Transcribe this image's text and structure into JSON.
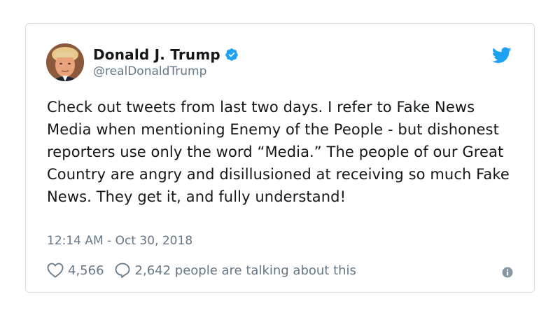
{
  "user": {
    "name": "Donald J. Trump",
    "handle": "@realDonaldTrump"
  },
  "tweet": {
    "text": "Check out tweets from last two days. I refer to Fake News Media when mentioning Enemy of the People - but dishonest reporters use only the word “Media.” The people of our Great Country are angry and disillusioned at receiving so much Fake News. They get it, and fully understand!",
    "timestamp": "12:14 AM - Oct 30, 2018"
  },
  "actions": {
    "likes": "4,566",
    "talking": "2,642 people are talking about this"
  },
  "icons": {
    "brand": "twitter-bird-icon",
    "verified": "verified-badge-icon",
    "like": "heart-icon",
    "reply": "speech-bubble-icon",
    "info": "info-icon"
  },
  "colors": {
    "twitter_blue": "#1da1f2",
    "text": "#14171a",
    "muted": "#657786",
    "border": "#d8dde2"
  }
}
